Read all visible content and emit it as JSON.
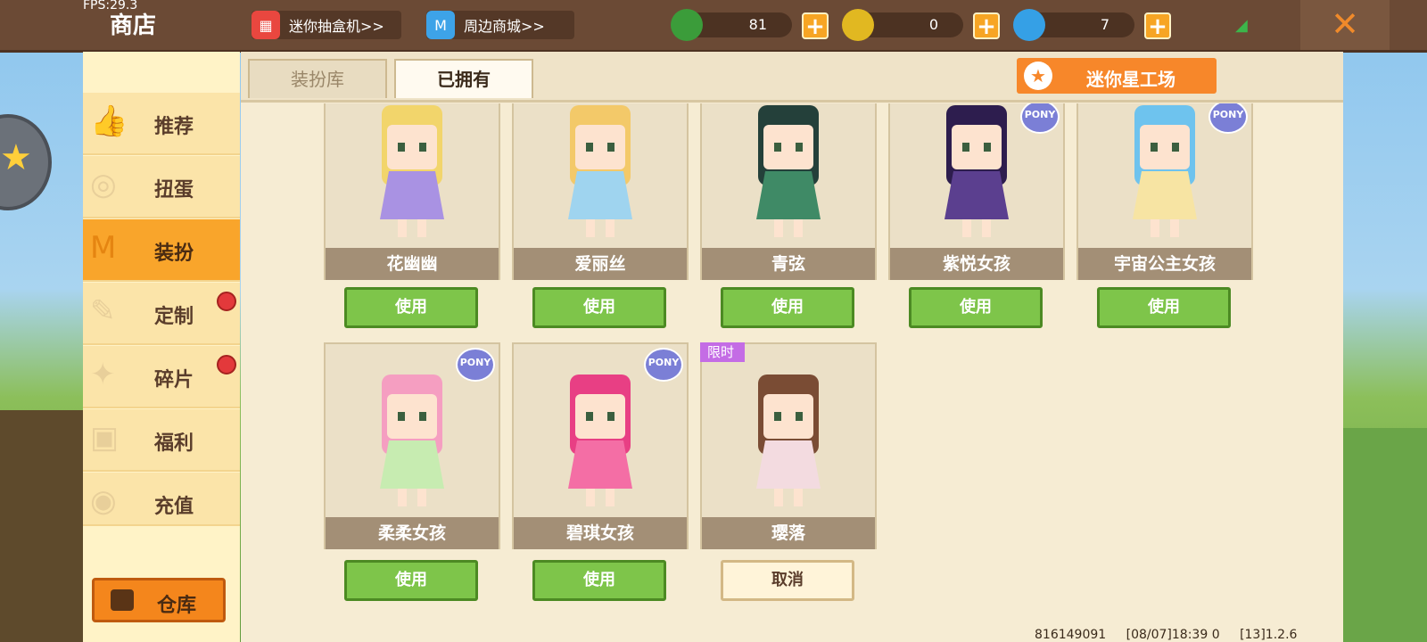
{
  "fps": "FPS:29.3",
  "header": {
    "title": "商店",
    "gacha_label": "迷你抽盒机>>",
    "mall_label": "周边商城>>",
    "currencies": [
      {
        "name": "green-gem",
        "value": "81",
        "color": "#3b9c3a"
      },
      {
        "name": "gold-coin",
        "value": "0",
        "color": "#e1b821"
      },
      {
        "name": "blue-coin",
        "value": "7",
        "color": "#35a0e6"
      }
    ]
  },
  "sidebar": {
    "items": [
      {
        "label": "推荐",
        "icon": "thumbs-up-icon",
        "active": false,
        "badge": false
      },
      {
        "label": "扭蛋",
        "icon": "capsule-icon",
        "active": false,
        "badge": false
      },
      {
        "label": "装扮",
        "icon": "shirt-icon",
        "active": true,
        "badge": false
      },
      {
        "label": "定制",
        "icon": "pencil-icon",
        "active": false,
        "badge": true
      },
      {
        "label": "碎片",
        "icon": "puzzle-icon",
        "active": false,
        "badge": true
      },
      {
        "label": "福利",
        "icon": "gift-icon",
        "active": false,
        "badge": false
      },
      {
        "label": "充值",
        "icon": "coins-icon",
        "active": false,
        "badge": false
      }
    ],
    "warehouse_label": "仓库"
  },
  "tabs": [
    {
      "label": "装扮库",
      "active": false
    },
    {
      "label": "已拥有",
      "active": true
    }
  ],
  "star_workshop_label": "迷你星工场",
  "skins": [
    {
      "name": "花幽幽",
      "button": "使用",
      "hair": "#f2d56b",
      "outfit": "#a992e3",
      "limited": false,
      "pony": false
    },
    {
      "name": "爱丽丝",
      "button": "使用",
      "hair": "#f3c969",
      "outfit": "#9fd4ef",
      "limited": false,
      "pony": false
    },
    {
      "name": "青弦",
      "button": "使用",
      "hair": "#24403a",
      "outfit": "#3f8a66",
      "limited": false,
      "pony": false
    },
    {
      "name": "紫悦女孩",
      "button": "使用",
      "hair": "#2d1d4e",
      "outfit": "#5b3f8f",
      "limited": false,
      "pony": true
    },
    {
      "name": "宇宙公主女孩",
      "button": "使用",
      "hair": "#6ec3ee",
      "outfit": "#f7e4a3",
      "limited": false,
      "pony": true
    },
    {
      "name": "柔柔女孩",
      "button": "使用",
      "hair": "#f59ec1",
      "outfit": "#c7ecb1",
      "limited": false,
      "pony": true
    },
    {
      "name": "碧琪女孩",
      "button": "使用",
      "hair": "#e83f84",
      "outfit": "#f46ea5",
      "limited": false,
      "pony": true
    },
    {
      "name": "璎落",
      "button": "取消",
      "hair": "#7a4c34",
      "outfit": "#f3dbe0",
      "limited": true,
      "pony": false
    }
  ],
  "limited_label": "限时",
  "pony_label": "PONY",
  "footer": {
    "uid": "816149091",
    "time": "[08/07]18:39 0",
    "version": "[13]1.2.6"
  }
}
